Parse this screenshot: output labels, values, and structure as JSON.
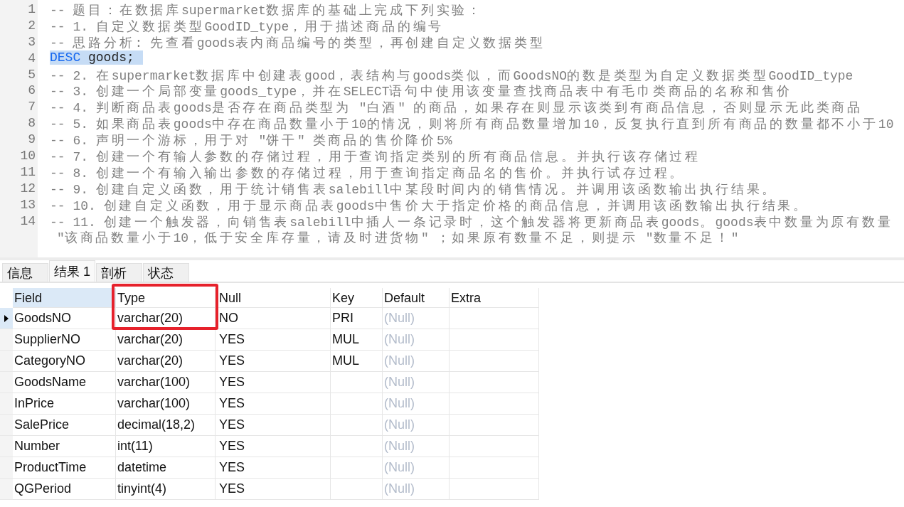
{
  "editor": {
    "lines": [
      {
        "number": "1",
        "selected": false,
        "tokens": [
          {
            "text": "-- 题目：在数据库supermarket数据库的基础上完成下列实验：",
            "kind": "comment"
          }
        ]
      },
      {
        "number": "2",
        "selected": false,
        "tokens": [
          {
            "text": "-- 1. 自定义数据类型GoodID_type，用于描述商品的编号",
            "kind": "comment"
          }
        ]
      },
      {
        "number": "3",
        "selected": false,
        "tokens": [
          {
            "text": "-- 思路分析: 先查看goods表内商品编号的类型，再创建自定义数据类型",
            "kind": "comment"
          }
        ]
      },
      {
        "number": "4",
        "selected": true,
        "tokens": [
          {
            "text": "DESC",
            "kind": "keyword"
          },
          {
            "text": " goods;",
            "kind": "plain"
          }
        ]
      },
      {
        "number": "5",
        "selected": false,
        "tokens": [
          {
            "text": "-- 2. 在supermarket数据库中创建表good，表结构与goods类似，而GoodsNO的数是类型为自定义数据类型GoodID_type",
            "kind": "comment"
          }
        ]
      },
      {
        "number": "6",
        "selected": false,
        "tokens": [
          {
            "text": "-- 3. 创建一个局部变量goods_type，并在SELECT语句中使用该变量查找商品表中有毛巾类商品的名称和售价",
            "kind": "comment"
          }
        ]
      },
      {
        "number": "7",
        "selected": false,
        "tokens": [
          {
            "text": "-- 4. 判断商品表goods是否存在商品类型为 \"白酒\" 的商品，如果存在则显示该类到有商品信息，否则显示无此类商品",
            "kind": "comment"
          }
        ]
      },
      {
        "number": "8",
        "selected": false,
        "tokens": [
          {
            "text": "-- 5. 如果商品表goods中存在商品数量小于10的情况，则将所有商品数量增加10，反复执行直到所有商品的数量都不小于10",
            "kind": "comment"
          }
        ]
      },
      {
        "number": "9",
        "selected": false,
        "tokens": [
          {
            "text": "-- 6. 声明一个游标，用于对 \"饼干\" 类商品的售价降价5%",
            "kind": "comment"
          }
        ]
      },
      {
        "number": "10",
        "selected": false,
        "tokens": [
          {
            "text": "-- 7. 创建一个有输人参数的存储过程，用于查询指定类别的所有商品信息。并执行该存储过程",
            "kind": "comment"
          }
        ]
      },
      {
        "number": "11",
        "selected": false,
        "tokens": [
          {
            "text": "-- 8. 创建一个有输入输出参数的存储过程，用于查询指定商品名的售价。并执行试存过程。",
            "kind": "comment"
          }
        ]
      },
      {
        "number": "12",
        "selected": false,
        "tokens": [
          {
            "text": "-- 9. 创建自定义函数，用于统计销售表salebill中某段时间内的销售情况。并调用该函数输出执行结果。",
            "kind": "comment"
          }
        ]
      },
      {
        "number": "13",
        "selected": false,
        "tokens": [
          {
            "text": "-- 10. 创建自定义函数，用于显示商品表goods中售价大于指定价格的商品信息，并调用该函数输出执行结果。",
            "kind": "comment"
          }
        ]
      },
      {
        "number": "14",
        "selected": false,
        "tokens": [
          {
            "text": "-- 11. 创建一个触发器，向销售表salebill中插人一条记录时，这个触发器将更新商品表goods。goods表中数量为原有数量",
            "kind": "comment"
          }
        ],
        "continuation": [
          {
            "text": "\"该商品数量小于10，低于安全库存量，请及时进货物\" ；如果原有数量不足，则提示 \"数量不足！\"",
            "kind": "comment"
          }
        ]
      }
    ]
  },
  "result_tabs": [
    {
      "label": "信息",
      "selected": false
    },
    {
      "label": "结果 1",
      "selected": true
    },
    {
      "label": "剖析",
      "selected": false
    },
    {
      "label": "状态",
      "selected": false
    }
  ],
  "table": {
    "columns": [
      {
        "label": "Field",
        "selected": true,
        "framed": false
      },
      {
        "label": "Type",
        "selected": false,
        "framed": true
      },
      {
        "label": "Null",
        "selected": false,
        "framed": false
      },
      {
        "label": "Key",
        "selected": false,
        "framed": false
      },
      {
        "label": "Default",
        "selected": false,
        "framed": false
      },
      {
        "label": "Extra",
        "selected": false,
        "framed": false
      }
    ],
    "rows": [
      {
        "selected": true,
        "framed": true,
        "cells": [
          "GoodsNO",
          "varchar(20)",
          "NO",
          "PRI",
          {
            "text": "(Null)",
            "is_null": true
          },
          null
        ]
      },
      {
        "selected": false,
        "framed": false,
        "cells": [
          "SupplierNO",
          "varchar(20)",
          "YES",
          "MUL",
          {
            "text": "(Null)",
            "is_null": true
          },
          null
        ]
      },
      {
        "selected": false,
        "framed": false,
        "cells": [
          "CategoryNO",
          "varchar(20)",
          "YES",
          "MUL",
          {
            "text": "(Null)",
            "is_null": true
          },
          null
        ]
      },
      {
        "selected": false,
        "framed": false,
        "cells": [
          "GoodsName",
          "varchar(100)",
          "YES",
          null,
          {
            "text": "(Null)",
            "is_null": true
          },
          null
        ]
      },
      {
        "selected": false,
        "framed": false,
        "cells": [
          "InPrice",
          "varchar(100)",
          "YES",
          null,
          {
            "text": "(Null)",
            "is_null": true
          },
          null
        ]
      },
      {
        "selected": false,
        "framed": false,
        "cells": [
          "SalePrice",
          "decimal(18,2)",
          "YES",
          null,
          {
            "text": "(Null)",
            "is_null": true
          },
          null
        ]
      },
      {
        "selected": false,
        "framed": false,
        "cells": [
          "Number",
          "int(11)",
          "YES",
          null,
          {
            "text": "(Null)",
            "is_null": true
          },
          null
        ]
      },
      {
        "selected": false,
        "framed": false,
        "cells": [
          "ProductTime",
          "datetime",
          "YES",
          null,
          {
            "text": "(Null)",
            "is_null": true
          },
          null
        ]
      },
      {
        "selected": false,
        "framed": false,
        "cells": [
          "QGPeriod",
          "tinyint(4)",
          "YES",
          null,
          {
            "text": "(Null)",
            "is_null": true
          },
          null
        ]
      }
    ]
  }
}
